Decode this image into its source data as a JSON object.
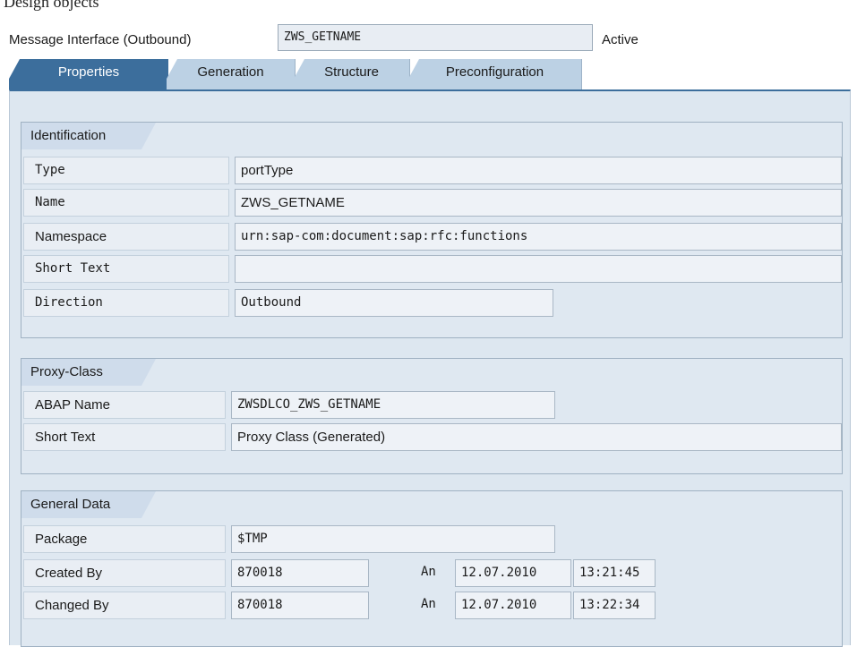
{
  "caption": "Design objects",
  "header": {
    "label": "Message Interface (Outbound)",
    "value": "ZWS_GETNAME",
    "status": "Active"
  },
  "tabs": [
    {
      "label": "Properties",
      "active": true
    },
    {
      "label": "Generation",
      "active": false
    },
    {
      "label": "Structure",
      "active": false
    },
    {
      "label": "Preconfiguration",
      "active": false
    }
  ],
  "identification": {
    "title": "Identification",
    "type_label": "Type",
    "type_value": "portType",
    "name_label": "Name",
    "name_value": "ZWS_GETNAME",
    "namespace_label": "Namespace",
    "namespace_value": "urn:sap-com:document:sap:rfc:functions",
    "shorttext_label": "Short Text",
    "shorttext_value": "",
    "direction_label": "Direction",
    "direction_value": "Outbound"
  },
  "proxy_class": {
    "title": "Proxy-Class",
    "abap_label": "ABAP Name",
    "abap_value": "ZWSDLCO_ZWS_GETNAME",
    "shorttext_label": "Short Text",
    "shorttext_value": "Proxy Class (Generated)"
  },
  "general_data": {
    "title": "General Data",
    "package_label": "Package",
    "package_value": "$TMP",
    "created_label": "Created By",
    "created_value": "870018",
    "created_an": "An",
    "created_date": "12.07.2010",
    "created_time": "13:21:45",
    "changed_label": "Changed By",
    "changed_value": "870018",
    "changed_an": "An",
    "changed_date": "12.07.2010",
    "changed_time": "13:22:34"
  },
  "colors": {
    "active_tab": "#3c6e9c",
    "inactive_tab": "#bcd1e4",
    "panel": "#dde7f0"
  }
}
